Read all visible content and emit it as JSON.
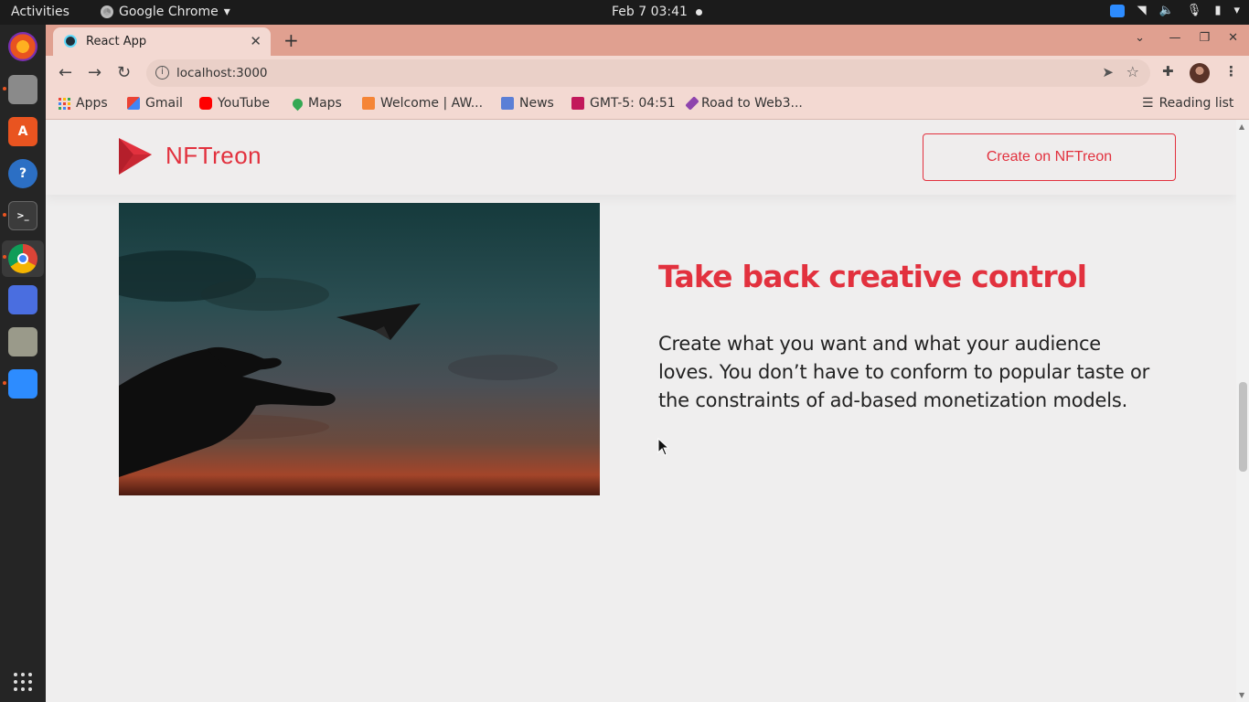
{
  "os": {
    "activities": "Activities",
    "app_menu": "Google Chrome",
    "clock": "Feb 7  03:41"
  },
  "browser": {
    "tab_title": "React App",
    "url": "localhost:3000",
    "bookmarks": [
      {
        "label": "Apps",
        "icon": "apps-grid-icon"
      },
      {
        "label": "Gmail",
        "icon": "gmail-icon"
      },
      {
        "label": "YouTube",
        "icon": "youtube-icon"
      },
      {
        "label": "Maps",
        "icon": "maps-pin-icon"
      },
      {
        "label": "Welcome | AW...",
        "icon": "aws-cube-icon"
      },
      {
        "label": "News",
        "icon": "news-icon"
      },
      {
        "label": "GMT-5: 04:51",
        "icon": "clock-bookmark-icon"
      },
      {
        "label": "Road to Web3...",
        "icon": "ethereum-icon"
      }
    ],
    "reading_list": "Reading list"
  },
  "page": {
    "brand": "NFTreon",
    "cta": "Create on NFTreon",
    "headline": "Take back creative control",
    "body": "Create what you want and what your audience loves. You don’t have to conform to popular taste or the constraints of ad-based monetization models."
  },
  "colors": {
    "accent": "#e2313e",
    "chrome_tabstrip": "#e0a090",
    "chrome_toolbar": "#f3d9d2",
    "page_bg": "#efeeee"
  }
}
